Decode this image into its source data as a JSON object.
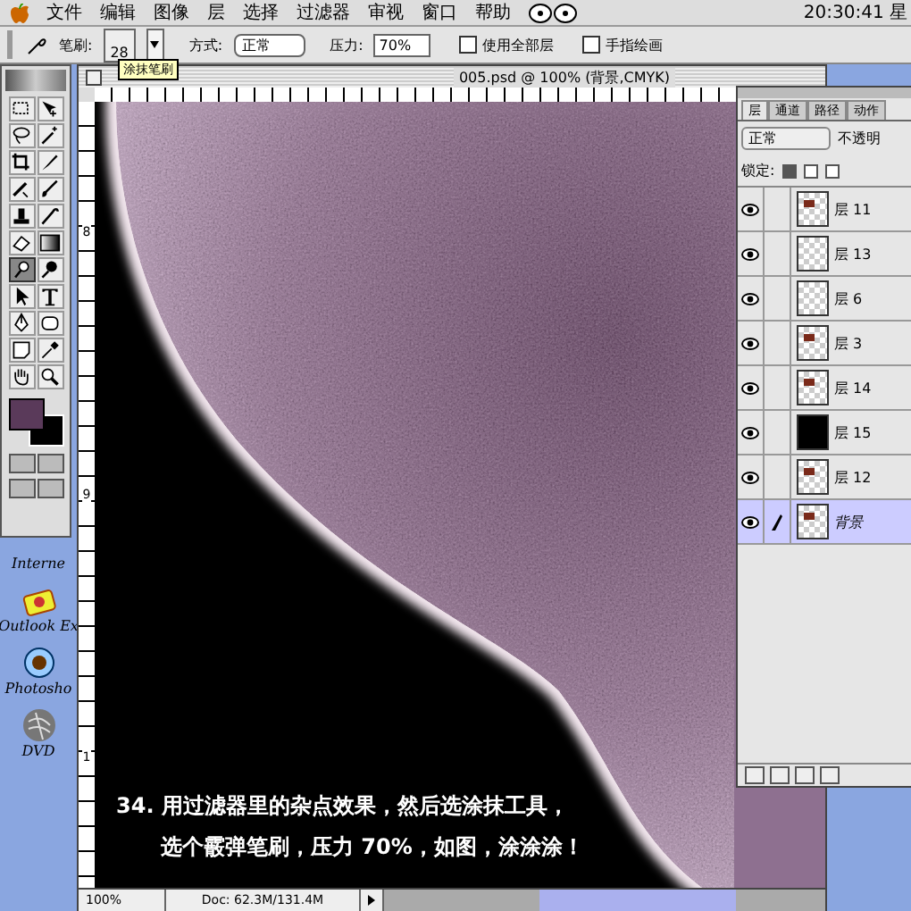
{
  "menu_bar": {
    "menus": [
      "文件",
      "编辑",
      "图像",
      "层",
      "选择",
      "过滤器",
      "审视",
      "窗口",
      "帮助"
    ],
    "clock": "20:30:41 星"
  },
  "options_bar": {
    "brush_label": "笔刷:",
    "brush_size": "28",
    "tooltip": "涂抹笔刷",
    "mode_label": "方式:",
    "mode": "正常",
    "pressure_label": "压力:",
    "pressure": "70%",
    "checkboxes": [
      {
        "label": "使用全部层",
        "checked": false
      },
      {
        "label": "手指绘画",
        "checked": false
      }
    ]
  },
  "toolbox": {
    "tools": [
      {
        "kind": "marquee",
        "selected": false
      },
      {
        "kind": "move",
        "selected": false
      },
      {
        "kind": "lasso",
        "selected": false
      },
      {
        "kind": "wand",
        "selected": false
      },
      {
        "kind": "crop",
        "selected": false
      },
      {
        "kind": "slice",
        "selected": false
      },
      {
        "kind": "heal",
        "selected": false
      },
      {
        "kind": "brush",
        "selected": false
      },
      {
        "kind": "stamp",
        "selected": false
      },
      {
        "kind": "history",
        "selected": false
      },
      {
        "kind": "eraser",
        "selected": false
      },
      {
        "kind": "gradient",
        "selected": false
      },
      {
        "kind": "smudge",
        "selected": true
      },
      {
        "kind": "dodge",
        "selected": false
      },
      {
        "kind": "arrow",
        "selected": false
      },
      {
        "kind": "type",
        "selected": false
      },
      {
        "kind": "pen",
        "selected": false
      },
      {
        "kind": "shape",
        "selected": false
      },
      {
        "kind": "notes",
        "selected": false
      },
      {
        "kind": "eyedropper",
        "selected": false
      },
      {
        "kind": "hand",
        "selected": false
      },
      {
        "kind": "zoom",
        "selected": false
      }
    ]
  },
  "desktop_icons": [
    {
      "label": "Interne",
      "kind": "hidden"
    },
    {
      "label": "Outlook Ex",
      "kind": "mail"
    },
    {
      "label": "Photosho",
      "kind": "eye"
    },
    {
      "label": "DVD",
      "kind": "disc"
    }
  ],
  "document": {
    "title": "005.psd @ 100% (背景,CMYK)",
    "ruler_marks": [
      "8",
      "9",
      "1"
    ],
    "zoom": "100%",
    "doc_info": "Doc: 62.3M/131.4M",
    "caption": [
      "34. 用过滤器里的杂点效果，然后选涂抹工具，",
      "选个霰弹笔刷，压力 70%，如图，涂涂涂！"
    ]
  },
  "layers_panel": {
    "tabs": [
      {
        "label": "层",
        "selected": true
      },
      {
        "label": "通道",
        "selected": false
      },
      {
        "label": "路径",
        "selected": false
      },
      {
        "label": "动作",
        "selected": false
      }
    ],
    "blend_mode": "正常",
    "opacity_label": "不透明",
    "lock_label": "锁定:",
    "locks": [
      {
        "checked": true
      },
      {
        "checked": false
      },
      {
        "checked": false
      }
    ],
    "layers": [
      {
        "name": "层 11",
        "visible": true,
        "selected": false,
        "kind": "image"
      },
      {
        "name": "层 13",
        "visible": true,
        "selected": false,
        "kind": "empty"
      },
      {
        "name": "层 6",
        "visible": true,
        "selected": false,
        "kind": "empty"
      },
      {
        "name": "层 3",
        "visible": true,
        "selected": false,
        "kind": "image"
      },
      {
        "name": "层 14",
        "visible": true,
        "selected": false,
        "kind": "image"
      },
      {
        "name": "层 15",
        "visible": true,
        "selected": false,
        "kind": "black"
      },
      {
        "name": "层 12",
        "visible": true,
        "selected": false,
        "kind": "image"
      },
      {
        "name": "背景",
        "visible": true,
        "selected": true,
        "kind": "image"
      }
    ]
  }
}
